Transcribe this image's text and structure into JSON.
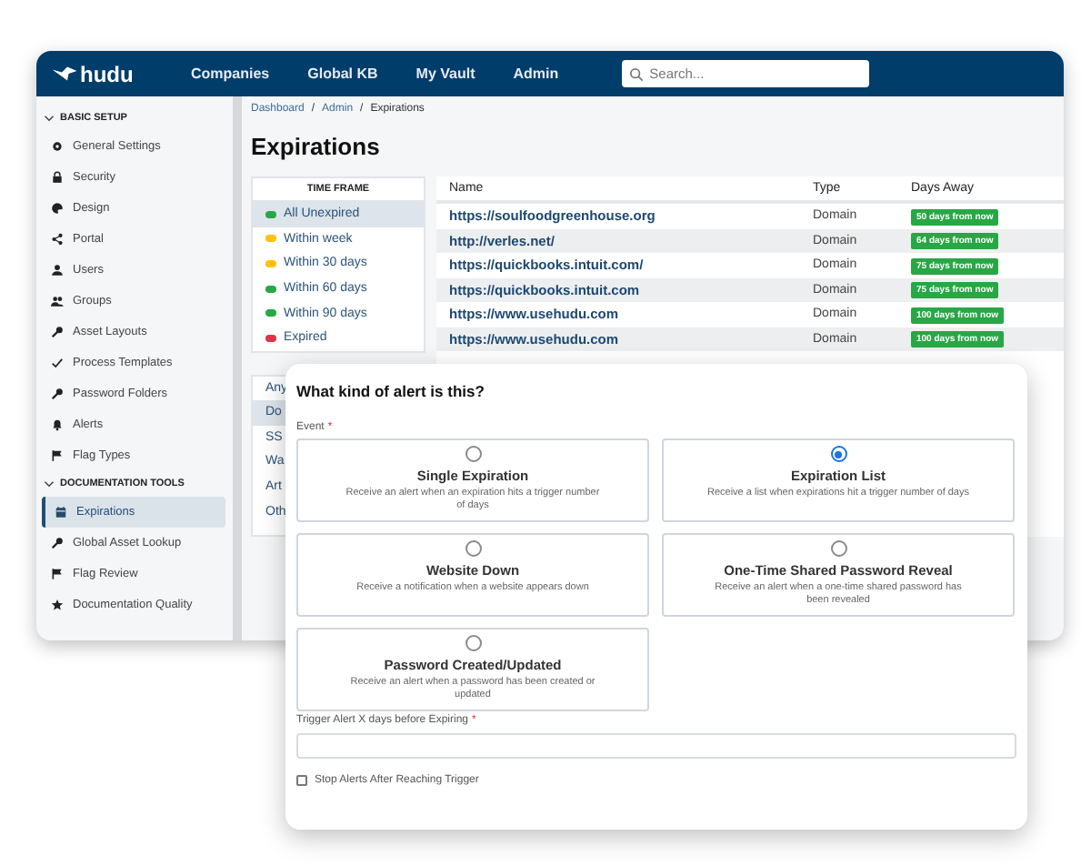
{
  "header": {
    "logo": "hudu",
    "nav": [
      {
        "label": "Companies"
      },
      {
        "label": "Global KB"
      },
      {
        "label": "My Vault"
      },
      {
        "label": "Admin"
      }
    ],
    "search": {
      "placeholder": "Search..."
    }
  },
  "sidebar": {
    "sections": [
      {
        "title": "BASIC SETUP",
        "expanded": true,
        "items": [
          {
            "label": "General Settings",
            "selected": false
          },
          {
            "label": "Security",
            "selected": false
          },
          {
            "label": "Design",
            "selected": false
          },
          {
            "label": "Portal",
            "selected": false
          },
          {
            "label": "Users",
            "selected": false
          },
          {
            "label": "Groups",
            "selected": false
          },
          {
            "label": "Asset Layouts",
            "selected": false
          },
          {
            "label": "Process Templates",
            "selected": false
          },
          {
            "label": "Password Folders",
            "selected": false
          },
          {
            "label": "Alerts",
            "selected": false
          },
          {
            "label": "Flag Types",
            "selected": false
          }
        ]
      },
      {
        "title": "DOCUMENTATION TOOLS",
        "expanded": true,
        "items": [
          {
            "label": "Expirations",
            "selected": true
          },
          {
            "label": "Global Asset Lookup",
            "selected": false
          },
          {
            "label": "Flag Review",
            "selected": false
          },
          {
            "label": "Documentation Quality",
            "selected": false
          }
        ]
      }
    ]
  },
  "breadcrumb": [
    {
      "label": "Dashboard",
      "kind": "link"
    },
    {
      "label": "/",
      "kind": "sep"
    },
    {
      "label": "Admin",
      "kind": "link"
    },
    {
      "label": "/",
      "kind": "sep"
    },
    {
      "label": "Expirations",
      "kind": "current"
    }
  ],
  "page_title": "Expirations",
  "time_frame": {
    "title": "TIME FRAME",
    "items": [
      {
        "label": "All Unexpired",
        "color": "#28a745",
        "selected": true
      },
      {
        "label": "Within week",
        "color": "#ffc107",
        "selected": false
      },
      {
        "label": "Within 30 days",
        "color": "#ffc107",
        "selected": false
      },
      {
        "label": "Within 60 days",
        "color": "#28a745",
        "selected": false
      },
      {
        "label": "Within 90 days",
        "color": "#28a745",
        "selected": false
      },
      {
        "label": "Expired",
        "color": "#dc3545",
        "selected": false
      }
    ]
  },
  "type_filter": {
    "items": [
      {
        "label": "Any",
        "selected": false
      },
      {
        "label": "Do",
        "selected": true
      },
      {
        "label": "SS",
        "selected": false
      },
      {
        "label": "Wa",
        "selected": false
      },
      {
        "label": "Art",
        "selected": false
      },
      {
        "label": "Oth",
        "selected": false
      }
    ]
  },
  "table": {
    "columns": [
      "Name",
      "Type",
      "Days Away"
    ],
    "rows": [
      {
        "name": "https://soulfoodgreenhouse.org",
        "type": "Domain",
        "days": "50 days from now"
      },
      {
        "name": "http://verles.net/",
        "type": "Domain",
        "days": "64 days from now"
      },
      {
        "name": "https://quickbooks.intuit.com/",
        "type": "Domain",
        "days": "75 days from now"
      },
      {
        "name": "https://quickbooks.intuit.com",
        "type": "Domain",
        "days": "75 days from now"
      },
      {
        "name": "https://www.usehudu.com",
        "type": "Domain",
        "days": "100 days from now"
      },
      {
        "name": "https://www.usehudu.com",
        "type": "Domain",
        "days": "100 days from now"
      }
    ]
  },
  "modal": {
    "title": "What kind of alert is this?",
    "event_label": "Event",
    "required_mark": "*",
    "options": [
      {
        "title": "Single Expiration",
        "description": "Receive an alert when an expiration hits a trigger number of days",
        "selected": false
      },
      {
        "title": "Expiration List",
        "description": "Receive a list when expirations hit a trigger number of days",
        "selected": true
      },
      {
        "title": "Website Down",
        "description": "Receive a notification when a website appears down",
        "selected": false
      },
      {
        "title": "One-Time Shared Password Reveal",
        "description": "Receive an alert when a one-time shared password has been revealed",
        "selected": false
      },
      {
        "title": "Password Created/Updated",
        "description": "Receive an alert when a password has been created or updated",
        "selected": false
      }
    ],
    "trigger_label": "Trigger Alert X days before Expiring",
    "trigger_required_mark": "*",
    "checkboxes": [
      {
        "label": "Stop Alerts After Reaching Trigger",
        "checked": false
      }
    ]
  }
}
